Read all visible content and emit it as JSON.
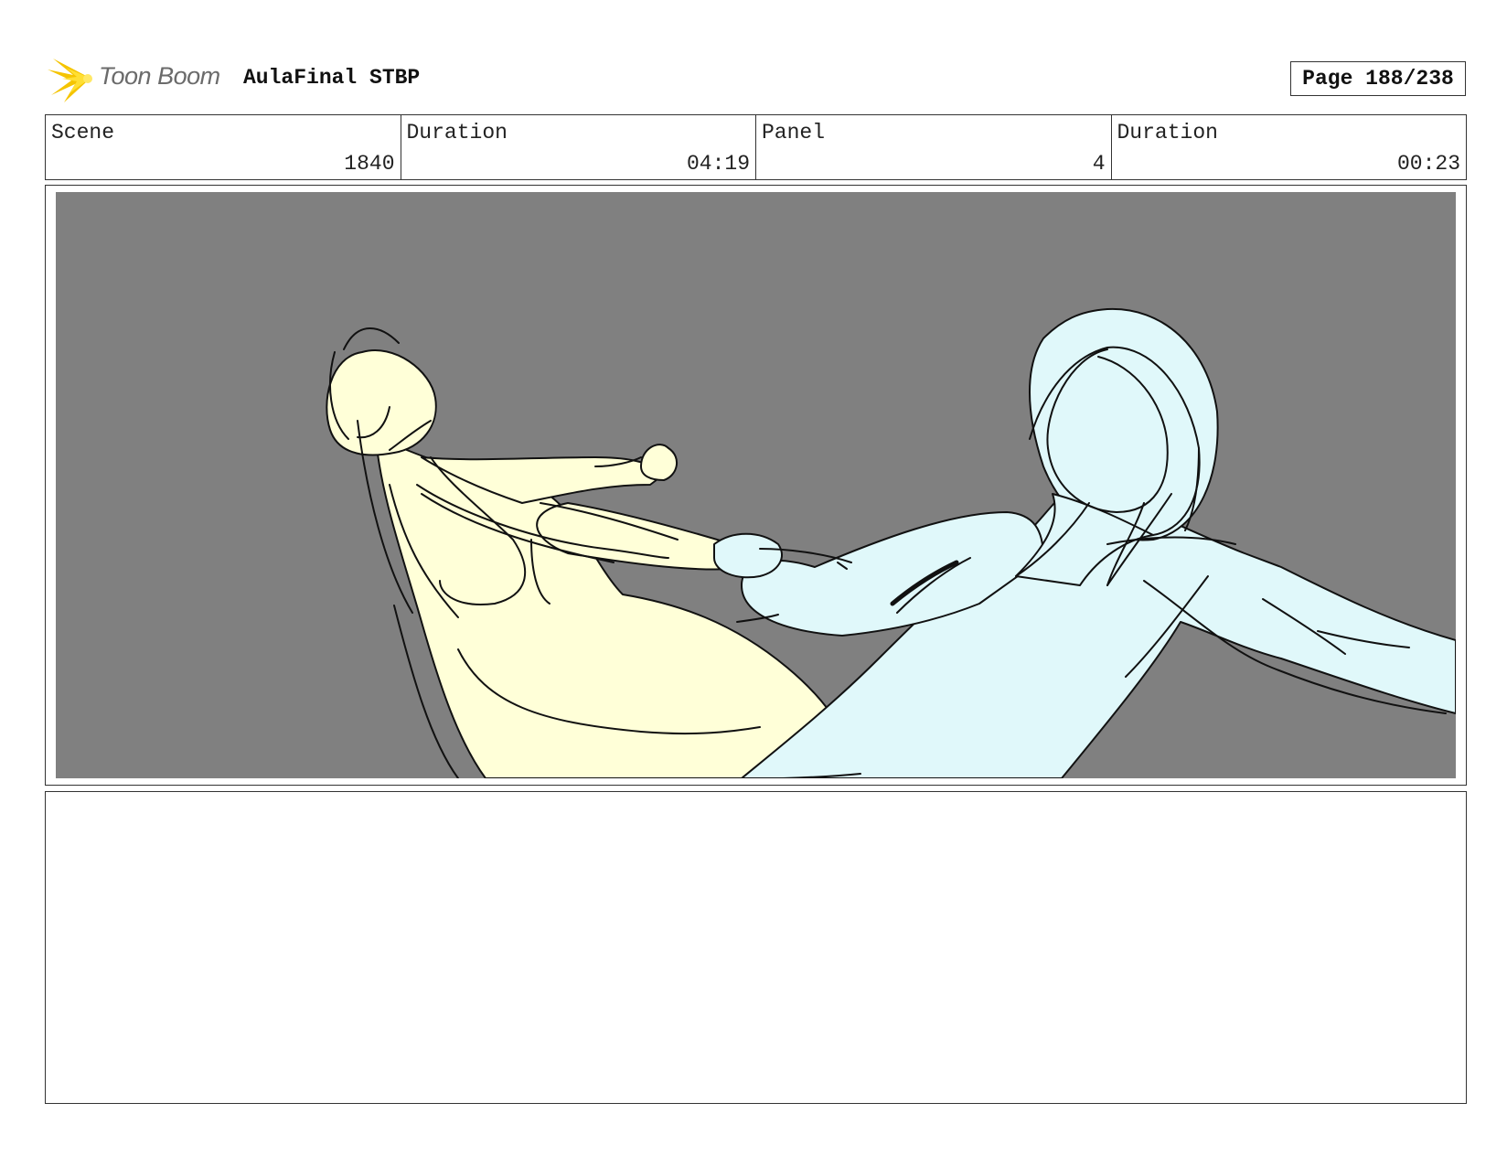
{
  "header": {
    "logo_text": "Toon Boom",
    "project_title": "AulaFinal STBP",
    "page_label": "Page 188/238"
  },
  "info": {
    "scene_label": "Scene",
    "scene_value": "1840",
    "scene_duration_label": "Duration",
    "scene_duration_value": "04:19",
    "panel_label": "Panel",
    "panel_value": "4",
    "panel_duration_label": "Duration",
    "panel_duration_value": "00:23"
  },
  "colors": {
    "background": "#808080",
    "figure_left_fill": "#ffffd8",
    "figure_right_fill": "#e0f8fa",
    "logo_accent": "#f5c400"
  },
  "notes": {
    "text": ""
  }
}
